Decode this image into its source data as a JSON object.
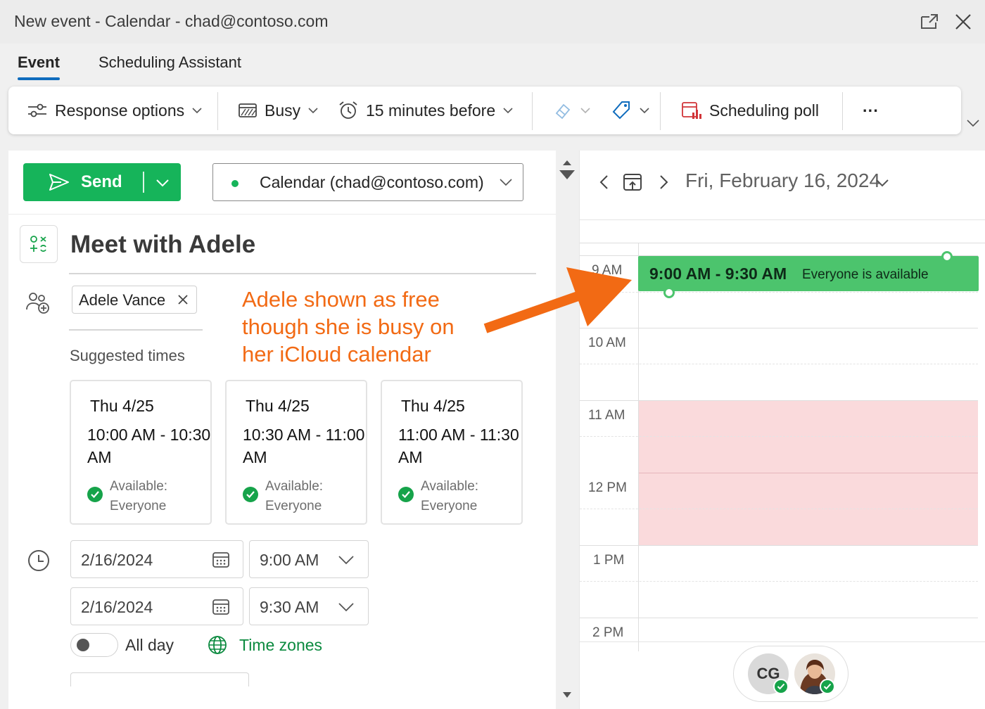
{
  "window": {
    "title": "New event - Calendar - chad@contoso.com"
  },
  "tabs": [
    {
      "label": "Event",
      "active": true
    },
    {
      "label": "Scheduling Assistant",
      "active": false
    }
  ],
  "ribbon": {
    "response_options": "Response options",
    "show_as": "Busy",
    "reminder": "15 minutes before",
    "scheduling_poll": "Scheduling poll",
    "more": "···"
  },
  "compose": {
    "send_label": "Send",
    "calendar_select": "Calendar (chad@contoso.com)",
    "event_title": "Meet with Adele",
    "attendees": [
      {
        "name": "Adele Vance"
      }
    ],
    "suggested_label": "Suggested times",
    "suggestions": [
      {
        "day": "Thu 4/25",
        "time": "10:00 AM - 10:30 AM",
        "status": "Available: Everyone"
      },
      {
        "day": "Thu 4/25",
        "time": "10:30 AM - 11:00 AM",
        "status": "Available: Everyone"
      },
      {
        "day": "Thu 4/25",
        "time": "11:00 AM - 11:30 AM",
        "status": "Available: Everyone"
      }
    ],
    "start_date": "2/16/2024",
    "start_time": "9:00 AM",
    "end_date": "2/16/2024",
    "end_time": "9:30 AM",
    "all_day_label": "All day",
    "all_day_on": false,
    "time_zones_label": "Time zones"
  },
  "annotation": {
    "line1": "Adele shown as free",
    "line2": "though she is busy on",
    "line3": "her iCloud calendar"
  },
  "day_view": {
    "date_title": "Fri, February 16, 2024",
    "hours": [
      "9 AM",
      "10 AM",
      "11 AM",
      "12 PM",
      "1 PM",
      "2 PM"
    ],
    "event": {
      "time": "9:00 AM - 9:30 AM",
      "status": "Everyone is available"
    },
    "participants": [
      {
        "initials": "CG",
        "available": true
      },
      {
        "initials": "",
        "available": true
      }
    ]
  },
  "colors": {
    "accent": "#0f6cbd",
    "send_green": "#16b45a",
    "event_green": "#4cc46d",
    "busy_pink": "#fadadc",
    "annotation_orange": "#f26a14",
    "timezone_green": "#0b8a3f"
  }
}
